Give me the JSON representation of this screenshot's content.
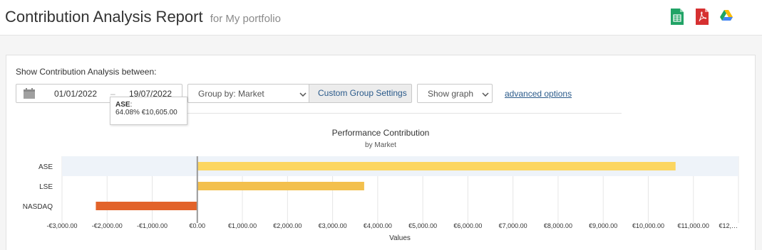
{
  "header": {
    "title": "Contribution Analysis Report",
    "subtitle": "for My portfolio",
    "icons": [
      "spreadsheet-icon",
      "pdf-icon",
      "google-drive-icon"
    ]
  },
  "controls": {
    "show_label": "Show Contribution Analysis between:",
    "date_from": "01/01/2022",
    "date_separator": "–",
    "date_to": "19/07/2022",
    "group_by": "Group by: Market",
    "custom_group_settings": "Custom Group Settings",
    "show_graph": "Show graph",
    "advanced_options": "advanced options"
  },
  "tooltip": {
    "category": "ASE",
    "colon": ":",
    "text": "64.08% €10,605.00"
  },
  "colors": {
    "ase_bar": "#fcd661",
    "lse_bar": "#f3c04d",
    "nasdaq_bar": "#e2632a",
    "link": "#2a5a8a"
  },
  "chart_data": {
    "type": "bar",
    "orientation": "horizontal",
    "title": "Performance Contribution",
    "subtitle": "by Market",
    "xlabel": "Values",
    "ylabel": "",
    "categories": [
      "ASE",
      "LSE",
      "NASDAQ"
    ],
    "values": [
      10605,
      3700,
      -2250
    ],
    "xlim": [
      -3000,
      12000
    ],
    "x_ticks": [
      -3000,
      -2000,
      -1000,
      0,
      1000,
      2000,
      3000,
      4000,
      5000,
      6000,
      7000,
      8000,
      9000,
      10000,
      11000,
      12000
    ],
    "x_tick_labels": [
      "-€3,000.00",
      "-€2,000.00",
      "-€1,000.00",
      "€0.00",
      "€1,000.00",
      "€2,000.00",
      "€3,000.00",
      "€4,000.00",
      "€5,000.00",
      "€6,000.00",
      "€7,000.00",
      "€8,000.00",
      "€9,000.00",
      "€10,000.00",
      "€11,000.00",
      "€12,…"
    ],
    "grid": true,
    "highlighted_category": "ASE"
  }
}
